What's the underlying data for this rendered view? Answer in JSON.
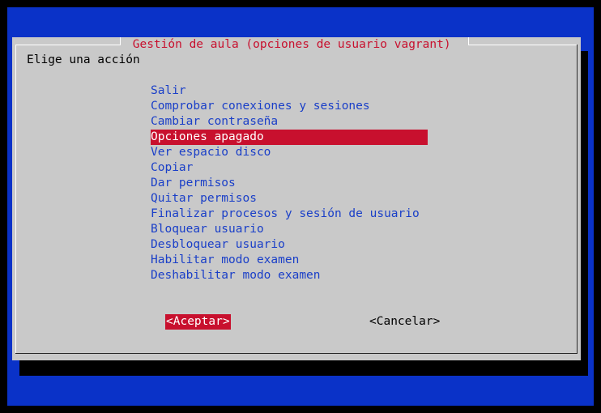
{
  "dialog": {
    "title": " Gestión de aula (opciones de usuario vagrant) ",
    "prompt": "Elige una acción",
    "menu": [
      {
        "label": "Salir",
        "selected": false
      },
      {
        "label": "Comprobar conexiones y sesiones",
        "selected": false
      },
      {
        "label": "Cambiar contraseña",
        "selected": false
      },
      {
        "label": "Opciones apagado",
        "selected": true
      },
      {
        "label": "Ver espacio disco",
        "selected": false
      },
      {
        "label": "Copiar",
        "selected": false
      },
      {
        "label": "Dar permisos",
        "selected": false
      },
      {
        "label": "Quitar permisos",
        "selected": false
      },
      {
        "label": "Finalizar procesos y sesión de usuario",
        "selected": false
      },
      {
        "label": "Bloquear usuario",
        "selected": false
      },
      {
        "label": "Desbloquear usuario",
        "selected": false
      },
      {
        "label": "Habilitar modo examen",
        "selected": false
      },
      {
        "label": "Deshabilitar modo examen",
        "selected": false
      }
    ],
    "buttons": {
      "ok": "<Aceptar>",
      "cancel": "<Cancelar>"
    }
  },
  "colors": {
    "background": "#0a32c8",
    "dialog": "#c9c9c9",
    "accent": "#c8102e",
    "item_text": "#1a3fc8"
  }
}
